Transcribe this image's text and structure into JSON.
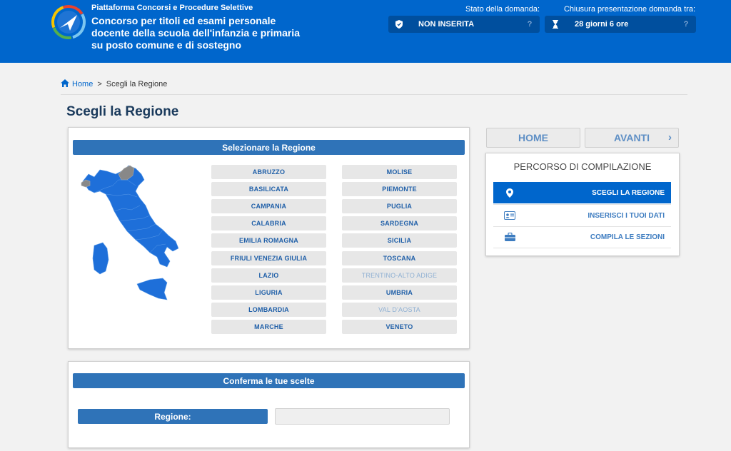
{
  "header": {
    "subtitle": "Piattaforma Concorsi e Procedure Selettive",
    "title": "Concorso per titoli ed esami personale docente della scuola dell'infanzia e primaria su posto comune e di sostegno",
    "status": {
      "label": "Stato della domanda:",
      "value": "NON INSERITA",
      "icon": "shield-icon",
      "help": "?"
    },
    "deadline": {
      "label": "Chiusura presentazione domanda tra:",
      "value": "28 giorni 6 ore",
      "icon": "hourglass-icon",
      "help": "?"
    }
  },
  "breadcrumb": {
    "home": "Home",
    "separator": ">",
    "current": "Scegli la Regione"
  },
  "page_title": "Scegli la Regione",
  "region_panel": {
    "header": "Selezionare la Regione",
    "regions": [
      {
        "label": "ABRUZZO",
        "enabled": true
      },
      {
        "label": "MOLISE",
        "enabled": true
      },
      {
        "label": "BASILICATA",
        "enabled": true
      },
      {
        "label": "PIEMONTE",
        "enabled": true
      },
      {
        "label": "CAMPANIA",
        "enabled": true
      },
      {
        "label": "PUGLIA",
        "enabled": true
      },
      {
        "label": "CALABRIA",
        "enabled": true
      },
      {
        "label": "SARDEGNA",
        "enabled": true
      },
      {
        "label": "EMILIA ROMAGNA",
        "enabled": true
      },
      {
        "label": "SICILIA",
        "enabled": true
      },
      {
        "label": "FRIULI VENEZIA GIULIA",
        "enabled": true
      },
      {
        "label": "TOSCANA",
        "enabled": true
      },
      {
        "label": "LAZIO",
        "enabled": true
      },
      {
        "label": "TRENTINO-ALTO ADIGE",
        "enabled": false
      },
      {
        "label": "LIGURIA",
        "enabled": true
      },
      {
        "label": "UMBRIA",
        "enabled": true
      },
      {
        "label": "LOMBARDIA",
        "enabled": true
      },
      {
        "label": "VAL D'AOSTA",
        "enabled": false
      },
      {
        "label": "MARCHE",
        "enabled": true
      },
      {
        "label": "VENETO",
        "enabled": true
      }
    ]
  },
  "confirm_panel": {
    "header": "Conferma le tue scelte",
    "region_label": "Regione:",
    "region_value": ""
  },
  "nav": {
    "home": "HOME",
    "next": "AVANTI"
  },
  "path": {
    "title": "PERCORSO DI COMPILAZIONE",
    "steps": [
      {
        "label": "SCEGLI LA REGIONE",
        "icon": "map-pin-icon",
        "active": true
      },
      {
        "label": "INSERISCI I TUOI DATI",
        "icon": "id-card-icon",
        "active": false
      },
      {
        "label": "COMPILA LE SEZIONI",
        "icon": "briefcase-icon",
        "active": false
      }
    ]
  },
  "colors": {
    "header_bg": "#0066cc",
    "bar_bg": "#2f73b8",
    "map_region": "#1e6fd9",
    "map_disabled": "#888888"
  }
}
